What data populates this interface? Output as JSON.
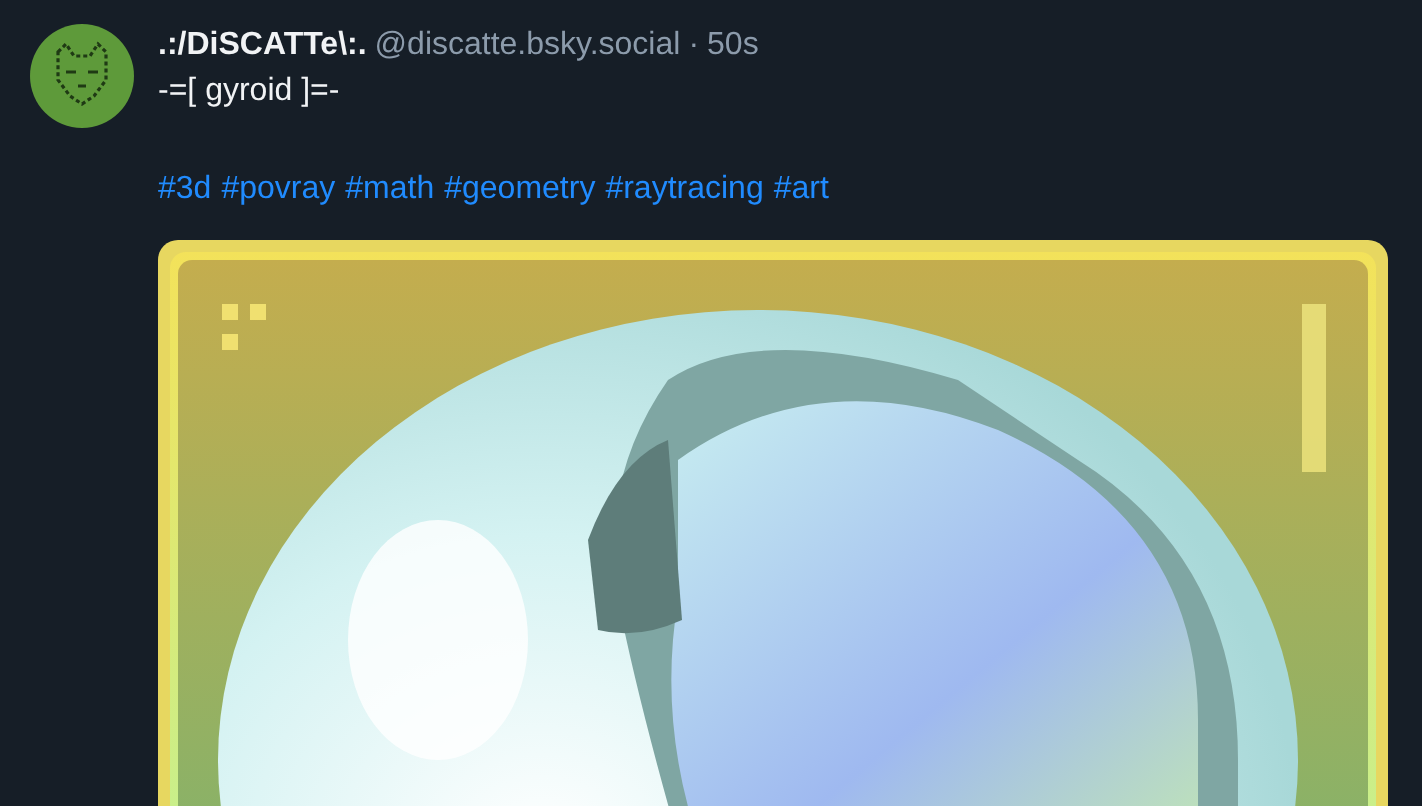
{
  "post": {
    "author": ".:/DiSCATTe\\:.",
    "handle": "@discatte.bsky.social",
    "separator": "·",
    "time": "50s",
    "lines": [
      "-=[ gyroid ]=-"
    ],
    "hashtags": [
      "#3d",
      "#povray",
      "#math",
      "#geometry",
      "#raytracing",
      "#art"
    ]
  }
}
